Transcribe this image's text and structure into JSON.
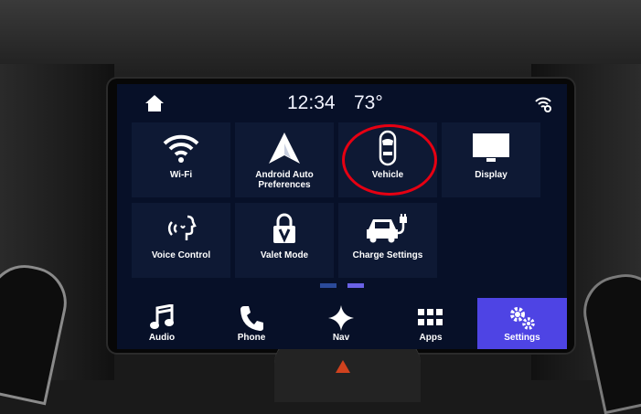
{
  "status_bar": {
    "time": "12:34",
    "temperature": "73°"
  },
  "tiles": [
    {
      "label": "Wi-Fi",
      "icon": "wifi-icon"
    },
    {
      "label": "Android Auto Preferences",
      "icon": "android-auto-icon"
    },
    {
      "label": "Vehicle",
      "icon": "vehicle-icon"
    },
    {
      "label": "Display",
      "icon": "display-icon"
    },
    {
      "label": "Voice Control",
      "icon": "voice-control-icon"
    },
    {
      "label": "Valet Mode",
      "icon": "valet-lock-icon"
    },
    {
      "label": "Charge Settings",
      "icon": "charge-car-icon"
    }
  ],
  "bottom_nav": [
    {
      "label": "Audio",
      "icon": "music-note-icon"
    },
    {
      "label": "Phone",
      "icon": "phone-icon"
    },
    {
      "label": "Nav",
      "icon": "nav-star-icon"
    },
    {
      "label": "Apps",
      "icon": "apps-grid-icon"
    },
    {
      "label": "Settings",
      "icon": "gears-icon",
      "active": true
    }
  ],
  "colors": {
    "screen_bg": "#071028",
    "tile_bg": "#0e1934",
    "active_nav": "#4e44e4",
    "highlight_circle": "#e60012"
  }
}
